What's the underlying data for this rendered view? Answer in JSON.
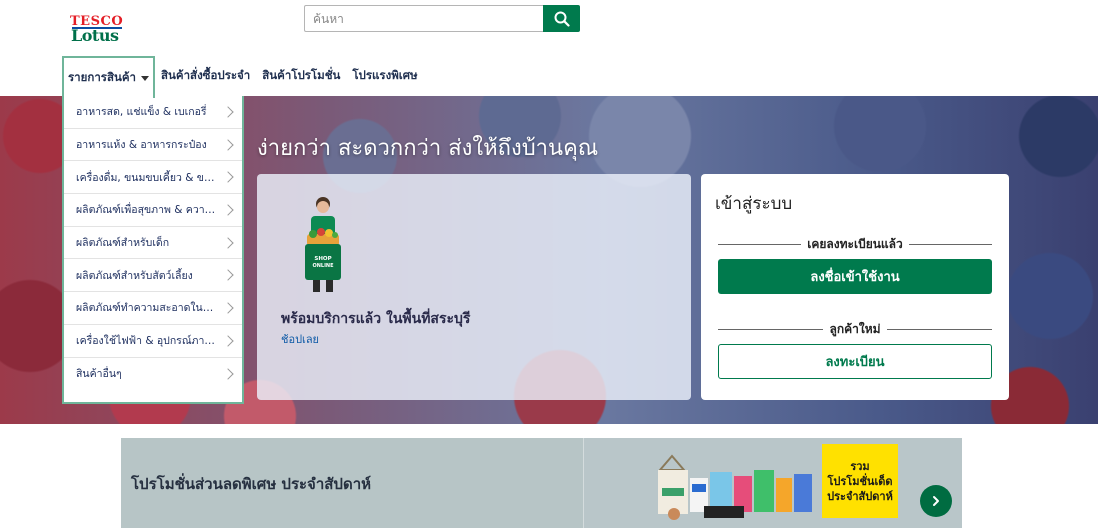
{
  "brand": {
    "logo_top": "TESCO",
    "logo_bottom": "Lotus"
  },
  "search": {
    "placeholder": "ค้นหา",
    "value": ""
  },
  "nav": {
    "items": [
      {
        "label": "รายการสินค้า"
      },
      {
        "label": "สินค้าสั่งซื้อประจำ"
      },
      {
        "label": "สินค้าโปรโมชั่น"
      },
      {
        "label": "โปรแรงพิเศษ"
      }
    ]
  },
  "categories": [
    {
      "label": "อาหารสด, แช่แข็ง & เบเกอรี่"
    },
    {
      "label": "อาหารแห้ง & อาหารกระป๋อง"
    },
    {
      "label": "เครื่องดื่ม, ขนมขบเคี้ยว & ขนม"
    },
    {
      "label": "ผลิตภัณฑ์เพื่อสุขภาพ & ความงาม"
    },
    {
      "label": "ผลิตภัณฑ์สำหรับเด็ก"
    },
    {
      "label": "ผลิตภัณฑ์สำหรับสัตว์เลี้ยง"
    },
    {
      "label": "ผลิตภัณฑ์ทำความสะอาดในบ้าน"
    },
    {
      "label": "เครื่องใช้ไฟฟ้า & อุปกรณ์ภายในบ้าน"
    },
    {
      "label": "สินค้าอื่นๆ"
    }
  ],
  "hero": {
    "title": "ง่ายกว่า สะดวกกว่า ส่งให้ถึงบ้านคุณ",
    "promo_heading": "พร้อมบริการแล้ว ในพื้นที่สระบุรี",
    "promo_link": "ช้อปเลย",
    "bag_text": "SHOP ONLINE"
  },
  "login": {
    "title": "เข้าสู่ระบบ",
    "registered_label": "เคยลงทะเบียนแล้ว",
    "login_button": "ลงชื่อเข้าใช้งาน",
    "new_customer_label": "ลูกค้าใหม่",
    "register_button": "ลงทะเบียน"
  },
  "weekly_banner": {
    "title": "โปรโมชั่นส่วนลดพิเศษ ประจำสัปดาห์",
    "tag_line1": "รวม",
    "tag_line2": "โปรโมชั่นเด็ด",
    "tag_line3": "ประจำสัปดาห์"
  },
  "colors": {
    "primary_green": "#007a4d",
    "nav_border": "#6fb59a",
    "tag_yellow": "#ffe100"
  }
}
